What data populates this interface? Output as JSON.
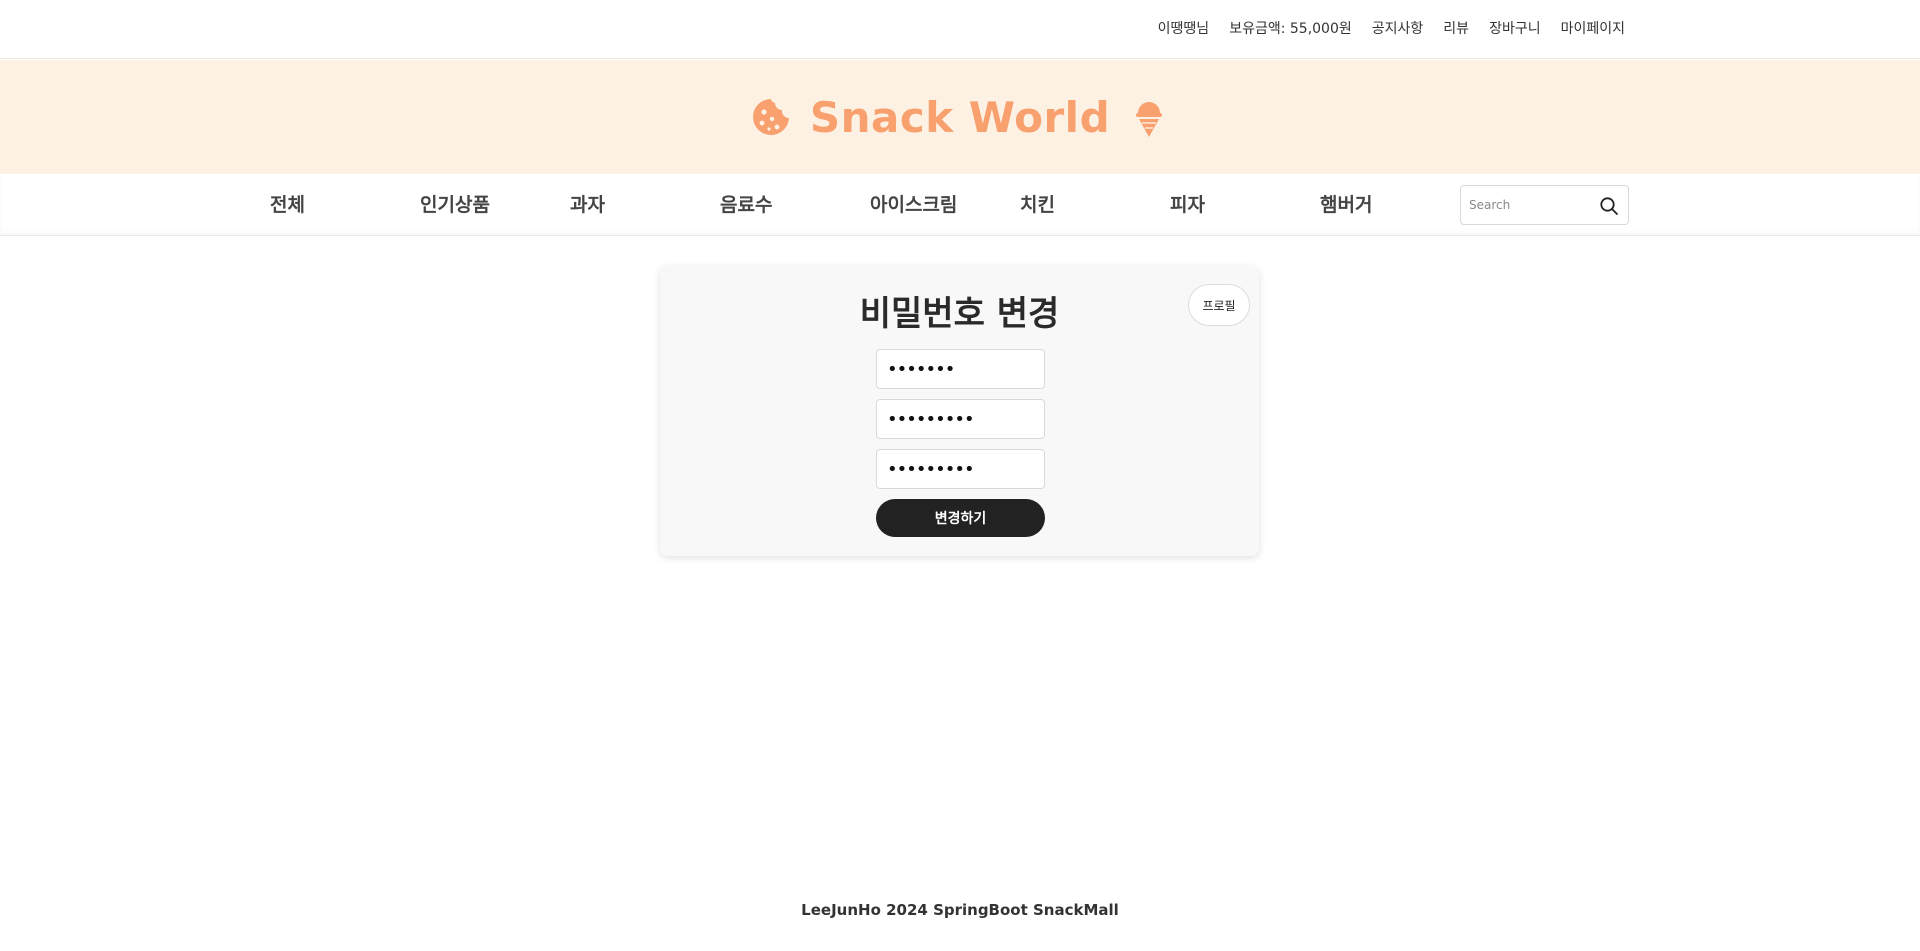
{
  "topbar": {
    "username": "이땡땡님",
    "balance": "보유금액: 55,000원",
    "links": [
      "공지사항",
      "리뷰",
      "장바구니",
      "마이페이지"
    ]
  },
  "banner": {
    "title": "Snack World",
    "left_icon": "cookie-icon",
    "right_icon": "ice-cream-icon",
    "color": "#f8a06e",
    "background": "#fdf1e3"
  },
  "nav": {
    "items": [
      "전체",
      "인기상품",
      "과자",
      "음료수",
      "아이스크림",
      "치킨",
      "피자",
      "햄버거"
    ],
    "search": {
      "placeholder": "Search",
      "icon": "search-icon"
    }
  },
  "card": {
    "title": "비밀번호 변경",
    "profile_button": "프로필",
    "fields": [
      {
        "value": "•••••••"
      },
      {
        "value": "•••••••••"
      },
      {
        "value": "•••••••••"
      }
    ],
    "submit_label": "변경하기"
  },
  "footer": {
    "text": "LeeJunHo 2024 SpringBoot SnackMall"
  }
}
